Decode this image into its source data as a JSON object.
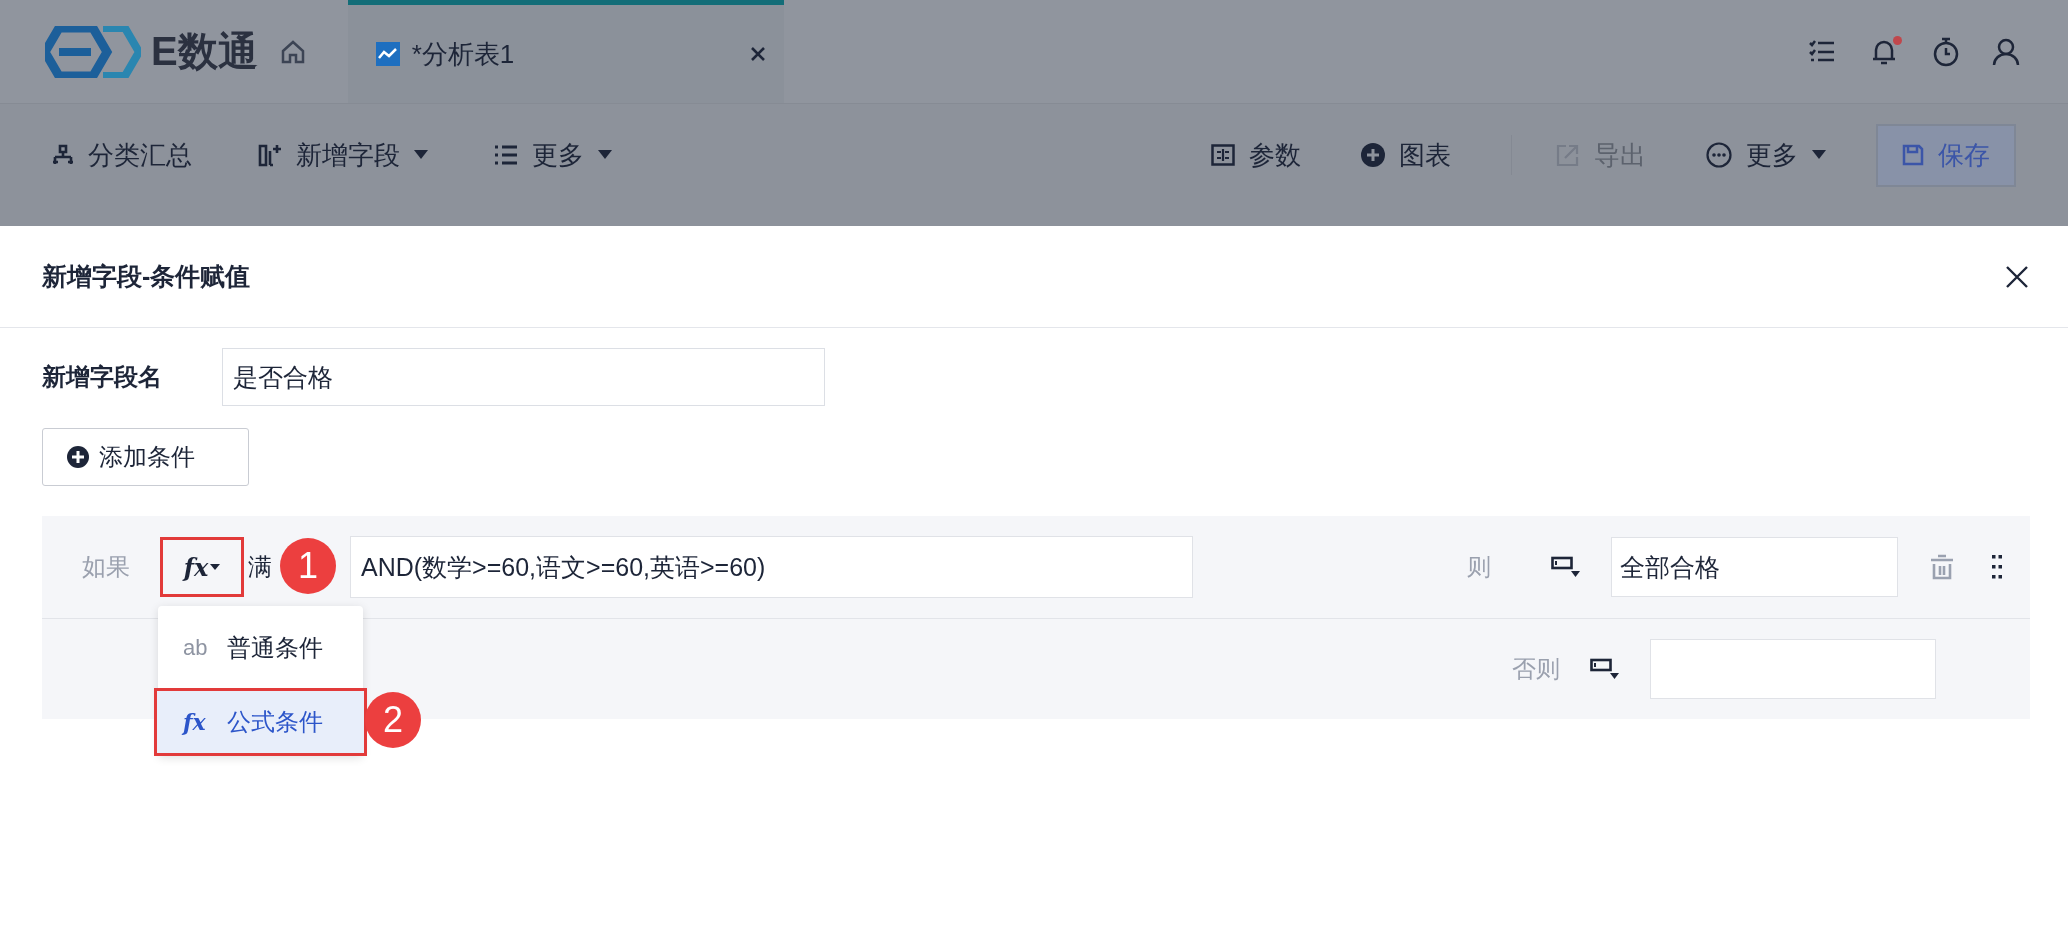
{
  "header": {
    "logo_text": "E数通",
    "tabs": [
      {
        "label": "*分析表1",
        "selected": true
      }
    ],
    "notifications": {
      "unread": true
    }
  },
  "toolbar": {
    "left": [
      {
        "label": "分类汇总",
        "dropdown": false
      },
      {
        "label": "新增字段",
        "dropdown": true
      },
      {
        "label": "更多",
        "dropdown": true
      }
    ],
    "right": [
      {
        "label": "参数",
        "dropdown": false,
        "disabled": false,
        "kind": "plain"
      },
      {
        "label": "图表",
        "dropdown": false,
        "disabled": false,
        "kind": "plain"
      },
      {
        "label": "导出",
        "dropdown": false,
        "disabled": true,
        "kind": "plain"
      },
      {
        "label": "更多",
        "dropdown": true,
        "disabled": false,
        "kind": "plain"
      },
      {
        "label": "保存",
        "dropdown": false,
        "disabled": false,
        "kind": "primary"
      }
    ]
  },
  "dialog": {
    "title": "新增字段-条件赋值",
    "field_name": {
      "label": "新增字段名",
      "value": "是否合格"
    },
    "add_button": "添加条件",
    "condition": {
      "if_label": "如果",
      "mode_icon": "fx",
      "mode_highlighted": true,
      "mode_text": "满",
      "formula": "AND(数学>=60,语文>=60,英语>=60)",
      "then_label": "则",
      "then_value": "全部合格"
    },
    "else_label": "否则",
    "menu": [
      {
        "icon_text": "ab",
        "label": "普通条件",
        "selected": false,
        "highlighted": false
      },
      {
        "icon_text": "fx",
        "label": "公式条件",
        "selected": true,
        "highlighted": true
      }
    ],
    "callouts": [
      "1",
      "2"
    ]
  }
}
